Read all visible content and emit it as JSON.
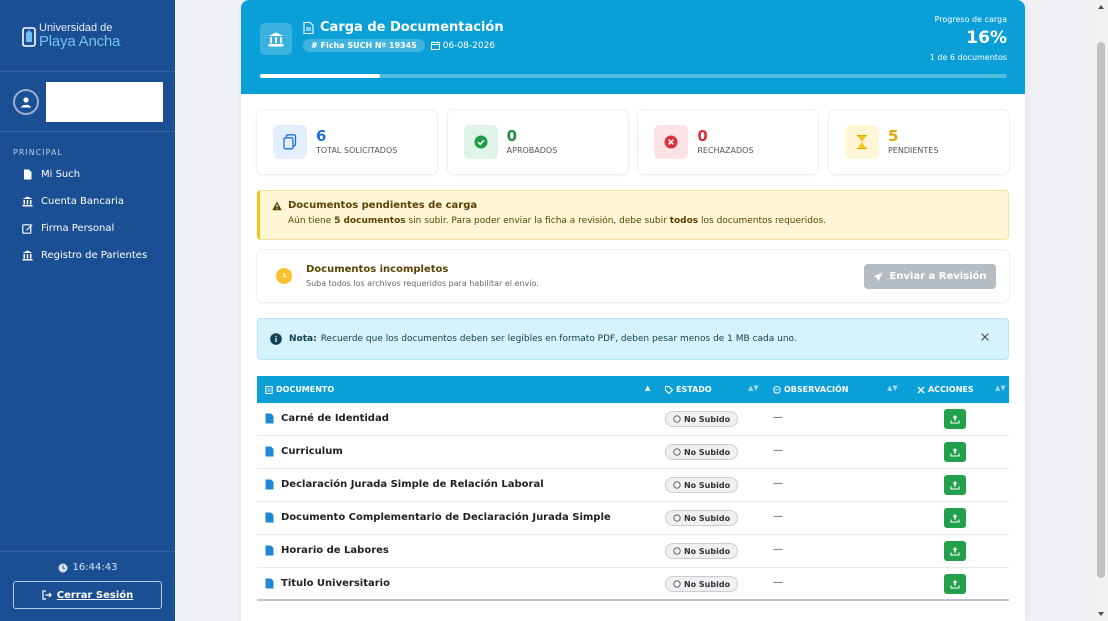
{
  "sidebar": {
    "brand_top": "Universidad de",
    "brand_bottom": "Playa Ancha",
    "section_label": "PRINCIPAL",
    "items": [
      {
        "label": "Mi Such",
        "icon": "file-icon"
      },
      {
        "label": "Cuenta Bancaria",
        "icon": "bank-icon"
      },
      {
        "label": "Firma Personal",
        "icon": "edit-icon"
      },
      {
        "label": "Registro de Parientes",
        "icon": "bank-icon"
      }
    ],
    "clock": "16:44:43",
    "logout_label": "Cerrar Sesión"
  },
  "header": {
    "title": "Carga de Documentación",
    "ficha": "# Ficha SUCH Nº 19345",
    "date": "06-08-2026",
    "progress_label": "Progreso de carga",
    "progress_pct_text": "16%",
    "progress_fraction": 0.16,
    "progress_count": "1 de 6 documentos"
  },
  "stats": [
    {
      "value": "6",
      "label": "TOTAL SOLICITADOS",
      "color": "#1e6fd9",
      "bg": "#e3efff",
      "icon": "copy-icon"
    },
    {
      "value": "0",
      "label": "APROBADOS",
      "color": "#1f8b45",
      "bg": "#dff4e6",
      "icon": "check-circle-icon"
    },
    {
      "value": "0",
      "label": "RECHAZADOS",
      "color": "#d9303e",
      "bg": "#fde3e5",
      "icon": "x-circle-icon"
    },
    {
      "value": "5",
      "label": "PENDIENTES",
      "color": "#e0a800",
      "bg": "#fff6d6",
      "icon": "hourglass-icon"
    }
  ],
  "alert": {
    "title": "Documentos pendientes de carga",
    "text_a": "Aún tiene ",
    "text_b": "5 documentos",
    "text_c": " sin subir. Para poder enviar la ficha a revisión, debe subir ",
    "text_d": "todos",
    "text_e": " los documentos requeridos."
  },
  "incomplete": {
    "title": "Documentos incompletos",
    "subtitle": "Suba todos los archivos requeridos para habilitar el envío.",
    "button": "Enviar a Revisión"
  },
  "note": {
    "label": "Nota:",
    "text": "Recuerde que los documentos deben ser legibles en formato PDF, deben pesar menos de 1 MB cada uno."
  },
  "table": {
    "columns": [
      "DOCUMENTO",
      "ESTADO",
      "OBSERVACIÓN",
      "ACCIONES"
    ],
    "rows": [
      {
        "documento": "Carné de Identidad",
        "estado": "No Subido",
        "observacion": "—"
      },
      {
        "documento": "Curriculum",
        "estado": "No Subido",
        "observacion": "—"
      },
      {
        "documento": "Declaración Jurada Simple de Relación Laboral",
        "estado": "No Subido",
        "observacion": "—"
      },
      {
        "documento": "Documento Complementario de Declaración Jurada Simple",
        "estado": "No Subido",
        "observacion": "—"
      },
      {
        "documento": "Horario de Labores",
        "estado": "No Subido",
        "observacion": "—"
      },
      {
        "documento": "Titulo Universitario",
        "estado": "No Subido",
        "observacion": "—"
      }
    ]
  },
  "colors": {
    "sidebar": "#1a4f93",
    "header": "#0a9fd6",
    "upload": "#22a04b"
  }
}
